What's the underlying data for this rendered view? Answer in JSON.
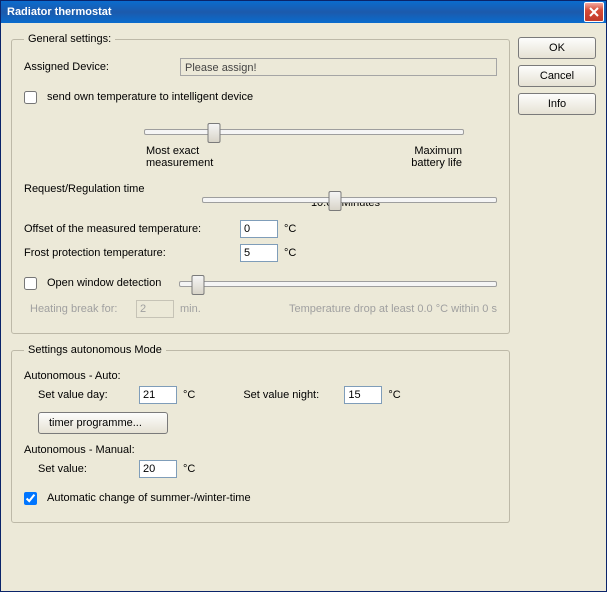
{
  "window": {
    "title": "Radiator thermostat"
  },
  "buttons": {
    "ok": "OK",
    "cancel": "Cancel",
    "info": "Info"
  },
  "general": {
    "legend": "General settings:",
    "assigned_device_label": "Assigned Device:",
    "assigned_device_value": "Please assign!",
    "send_own_temp_label": "send own temperature to intelligent device",
    "send_own_temp_checked": false,
    "slider1": {
      "left_label_line1": "Most exact",
      "left_label_line2": "measurement",
      "right_label_line1": "Maximum",
      "right_label_line2": "battery life",
      "position_percent": 22
    },
    "reg_time_label": "Request/Regulation time",
    "reg_time_display": "10:00 Minutes",
    "reg_time_position_percent": 45,
    "offset_label": "Offset of the measured temperature:",
    "offset_value": "0",
    "frost_label": "Frost protection temperature:",
    "frost_value": "5",
    "deg_c": "°C",
    "open_win_label": "Open window detection",
    "open_win_checked": false,
    "open_win_position_percent": 6,
    "heating_break_label": "Heating break for:",
    "heating_break_value": "2",
    "heating_break_unit": "min.",
    "temp_drop_label": "Temperature drop at least 0.0 °C within 0 s"
  },
  "auto": {
    "legend": "Settings autonomous Mode",
    "auto_title": "Autonomous - Auto:",
    "set_day_label": "Set value day:",
    "set_day_value": "21",
    "set_night_label": "Set value night:",
    "set_night_value": "15",
    "deg_c": "°C",
    "timer_btn": "timer programme...",
    "manual_title": "Autonomous - Manual:",
    "set_value_label": "Set value:",
    "set_value_value": "20",
    "auto_summer_label": "Automatic change of summer-/winter-time",
    "auto_summer_checked": true
  }
}
